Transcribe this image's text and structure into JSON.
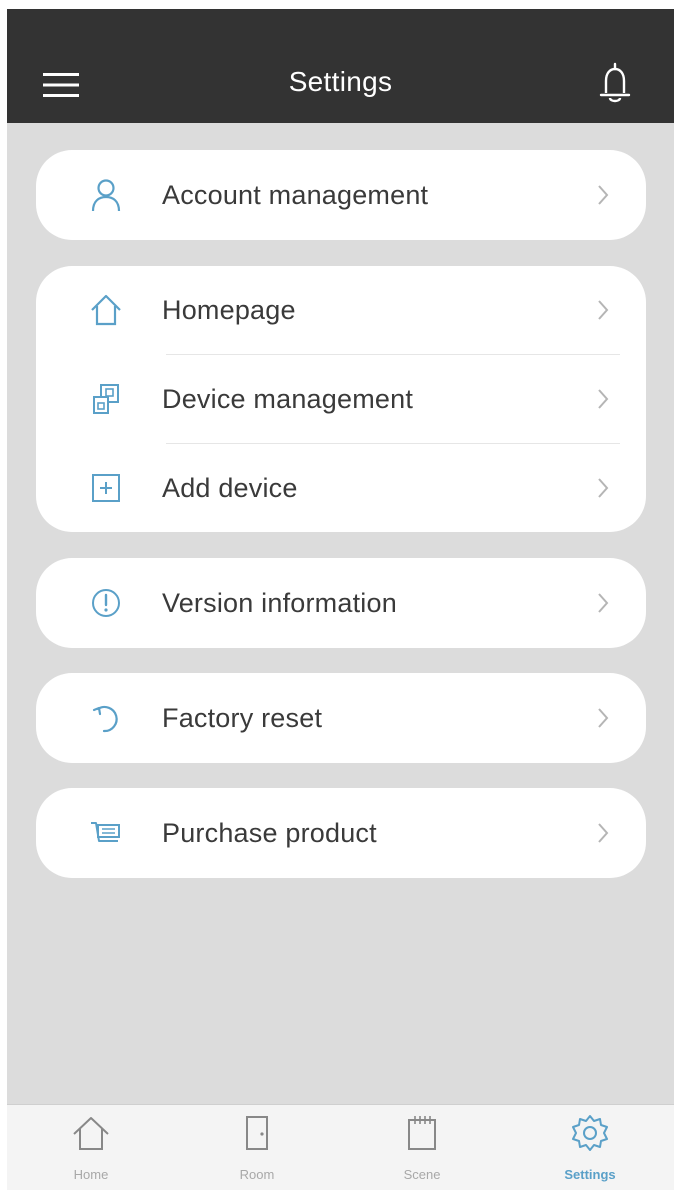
{
  "header": {
    "title": "Settings",
    "menu_icon": "hamburger-menu-icon",
    "bell_icon": "bell-icon"
  },
  "menu": {
    "account": {
      "label": "Account management",
      "icon": "user-icon"
    },
    "homepage": {
      "label": "Homepage",
      "icon": "home-outline-icon"
    },
    "device_management": {
      "label": "Device management",
      "icon": "device-management-icon"
    },
    "add_device": {
      "label": "Add device",
      "icon": "add-square-icon"
    },
    "version": {
      "label": "Version information",
      "icon": "info-circle-icon"
    },
    "factory_reset": {
      "label": "Factory reset",
      "icon": "reset-icon"
    },
    "purchase": {
      "label": "Purchase product",
      "icon": "cart-icon"
    }
  },
  "tabbar": {
    "tabs": [
      {
        "label": "Home",
        "icon": "home-icon",
        "active": false
      },
      {
        "label": "Room",
        "icon": "door-icon",
        "active": false
      },
      {
        "label": "Scene",
        "icon": "scene-icon",
        "active": false
      },
      {
        "label": "Settings",
        "icon": "gear-icon",
        "active": true
      }
    ]
  },
  "colors": {
    "header_bg": "#333333",
    "page_bg": "#dcdcdc",
    "card_bg": "#ffffff",
    "accent": "#5aa0c8",
    "text": "#3a3a3a"
  }
}
